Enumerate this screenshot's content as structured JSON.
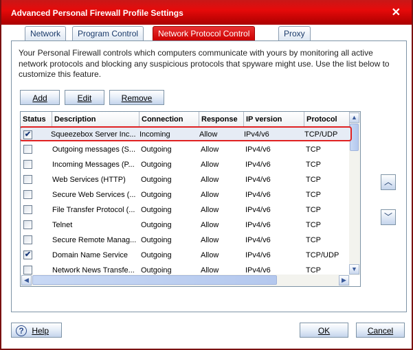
{
  "window": {
    "title": "Advanced Personal Firewall Profile Settings",
    "close_icon": "close-icon"
  },
  "tabs": [
    {
      "label": "Network"
    },
    {
      "label": "Program Control"
    },
    {
      "label": "Network Protocol Control",
      "active": true
    },
    {
      "label": "Proxy"
    }
  ],
  "description": "Your Personal Firewall controls which computers communicate with yours by monitoring all active network protocols and blocking any suspicious protocols that spyware might use. Use the list below to customize this feature.",
  "toolbar": {
    "add": "Add",
    "edit": "Edit",
    "remove": "Remove"
  },
  "table": {
    "columns": [
      "Status",
      "Description",
      "Connection",
      "Response",
      "IP version",
      "Protocol"
    ],
    "rows": [
      {
        "checked": true,
        "description": "Squeezebox Server Inc...",
        "connection": "Incoming",
        "response": "Allow",
        "ip": "IPv4/v6",
        "protocol": "TCP/UDP",
        "selected": true
      },
      {
        "checked": false,
        "description": "Outgoing messages (S...",
        "connection": "Outgoing",
        "response": "Allow",
        "ip": "IPv4/v6",
        "protocol": "TCP"
      },
      {
        "checked": false,
        "description": "Incoming Messages (P...",
        "connection": "Outgoing",
        "response": "Allow",
        "ip": "IPv4/v6",
        "protocol": "TCP"
      },
      {
        "checked": false,
        "description": "Web Services (HTTP)",
        "connection": "Outgoing",
        "response": "Allow",
        "ip": "IPv4/v6",
        "protocol": "TCP"
      },
      {
        "checked": false,
        "description": "Secure Web Services (...",
        "connection": "Outgoing",
        "response": "Allow",
        "ip": "IPv4/v6",
        "protocol": "TCP"
      },
      {
        "checked": false,
        "description": "File Transfer Protocol (...",
        "connection": "Outgoing",
        "response": "Allow",
        "ip": "IPv4/v6",
        "protocol": "TCP"
      },
      {
        "checked": false,
        "description": "Telnet",
        "connection": "Outgoing",
        "response": "Allow",
        "ip": "IPv4/v6",
        "protocol": "TCP"
      },
      {
        "checked": false,
        "description": "Secure Remote Manag...",
        "connection": "Outgoing",
        "response": "Allow",
        "ip": "IPv4/v6",
        "protocol": "TCP"
      },
      {
        "checked": true,
        "description": "Domain Name Service",
        "connection": "Outgoing",
        "response": "Allow",
        "ip": "IPv4/v6",
        "protocol": "TCP/UDP"
      },
      {
        "checked": false,
        "description": "Network News Transfe...",
        "connection": "Outgoing",
        "response": "Allow",
        "ip": "IPv4/v6",
        "protocol": "TCP"
      }
    ]
  },
  "move": {
    "up_icon": "chevron-up-icon",
    "down_icon": "chevron-down-icon"
  },
  "footer": {
    "help": "Help",
    "ok": "OK",
    "cancel": "Cancel"
  },
  "colors": {
    "accent": "#e00000",
    "selection_outline": "#e02020"
  }
}
